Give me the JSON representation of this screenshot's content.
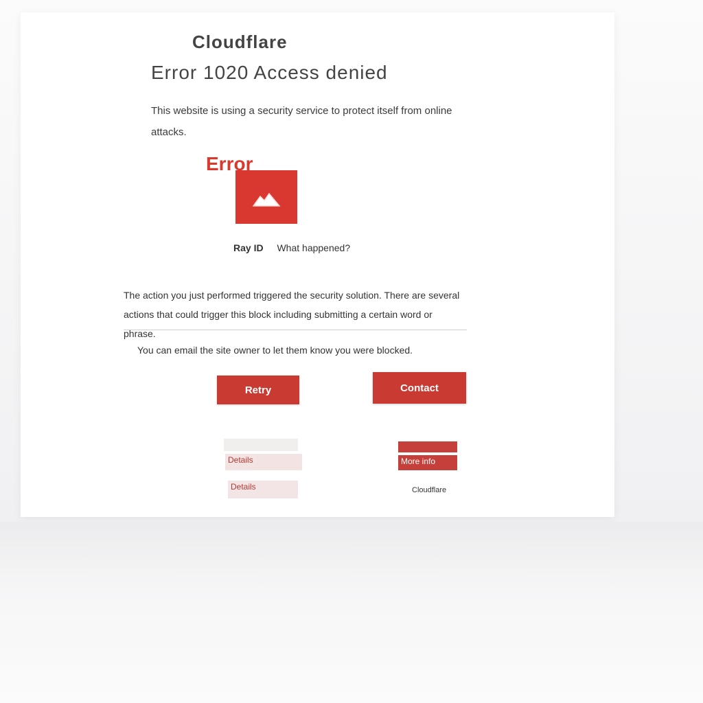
{
  "page": {
    "title": "Cloudflare",
    "subtitle": "Error 1020 Access denied",
    "intro": "This website is using a security service to protect itself from online attacks.",
    "red_label": "Error",
    "caption_strong": "Ray ID",
    "caption_rest": "What happened?",
    "para1": "The action you just performed triggered the security solution. There are several actions that could trigger this block including submitting a certain word or phrase.",
    "para2": "You can email the site owner to let them know you were blocked."
  },
  "buttons": {
    "left_label": "Retry",
    "right_label": "Contact"
  },
  "links": {
    "a": "",
    "b": "Details",
    "c": "Details",
    "d": "",
    "e": "More info"
  },
  "note": "Cloudflare",
  "colors": {
    "accent": "#d8382f",
    "button": "#c93a33"
  },
  "icons": {
    "logo": "cloud-icon"
  }
}
